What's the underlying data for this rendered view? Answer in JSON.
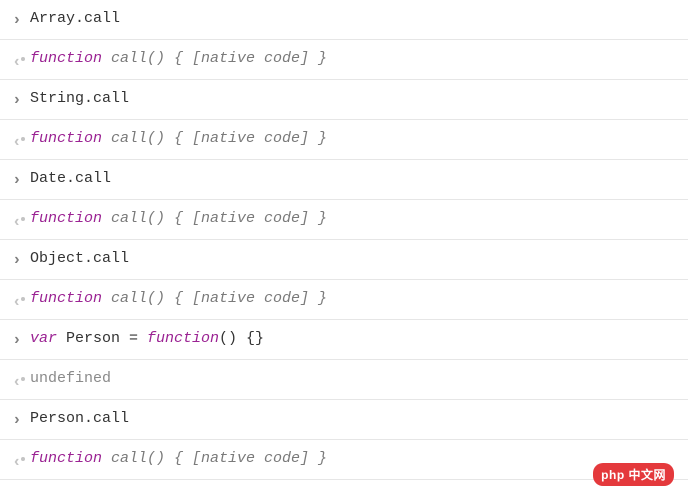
{
  "rows": [
    {
      "type": "input",
      "text": "Array.call"
    },
    {
      "type": "output",
      "kind": "native_call"
    },
    {
      "type": "input",
      "text": "String.call"
    },
    {
      "type": "output",
      "kind": "native_call"
    },
    {
      "type": "input",
      "text": "Date.call"
    },
    {
      "type": "output",
      "kind": "native_call"
    },
    {
      "type": "input",
      "text": "Object.call"
    },
    {
      "type": "output",
      "kind": "native_call"
    },
    {
      "type": "input",
      "kind": "var_person"
    },
    {
      "type": "output",
      "kind": "undefined"
    },
    {
      "type": "input",
      "text": "Person.call"
    },
    {
      "type": "output",
      "kind": "native_call"
    }
  ],
  "native_call": {
    "kw": "function",
    "rest": " call() { [native code] }"
  },
  "var_person": {
    "kw1": "var",
    "mid": " Person = ",
    "kw2": "function",
    "rest": "() {}"
  },
  "undefined_text": "undefined",
  "watermark": "php 中文网"
}
